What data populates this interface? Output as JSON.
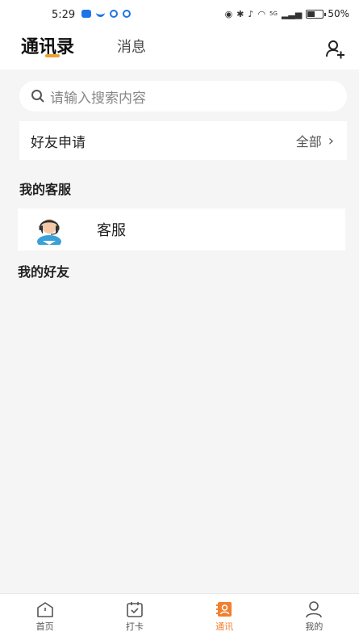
{
  "status_bar": {
    "time": "5:29",
    "network": "5G",
    "battery": "50%"
  },
  "header": {
    "tab_contacts": "通讯录",
    "tab_messages": "消息"
  },
  "search": {
    "placeholder": "请输入搜索内容"
  },
  "friend_request": {
    "label": "好友申请",
    "action": "全部"
  },
  "sections": {
    "my_service": "我的客服",
    "my_friends": "我的好友"
  },
  "service": {
    "name": "客服"
  },
  "bottom_nav": [
    {
      "label": "首页",
      "icon": "home-icon"
    },
    {
      "label": "打卡",
      "icon": "calendar-check-icon"
    },
    {
      "label": "通讯",
      "icon": "contacts-icon",
      "active": true
    },
    {
      "label": "我的",
      "icon": "profile-icon"
    }
  ],
  "colors": {
    "accent": "#f08030",
    "underline": "#f0a030",
    "status_app": "#1e73e8",
    "background": "#f5f5f5"
  }
}
